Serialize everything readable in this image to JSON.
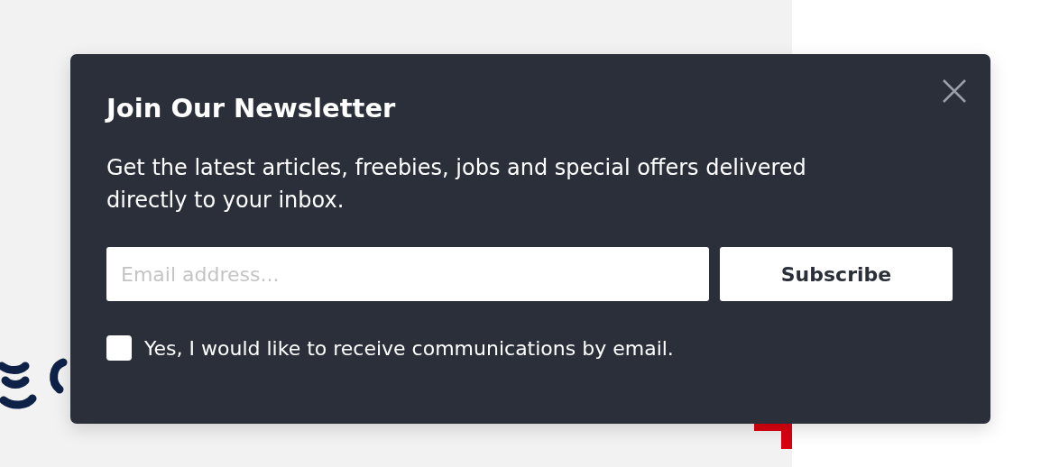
{
  "modal": {
    "title": "Join Our Newsletter",
    "description": "Get the latest articles, freebies, jobs and special offers delivered directly to your inbox.",
    "email": {
      "placeholder": "Email address..."
    },
    "subscribe_button": "Subscribe",
    "consent": {
      "label": "Yes, I would like to receive communications by email.",
      "checked": false
    }
  }
}
